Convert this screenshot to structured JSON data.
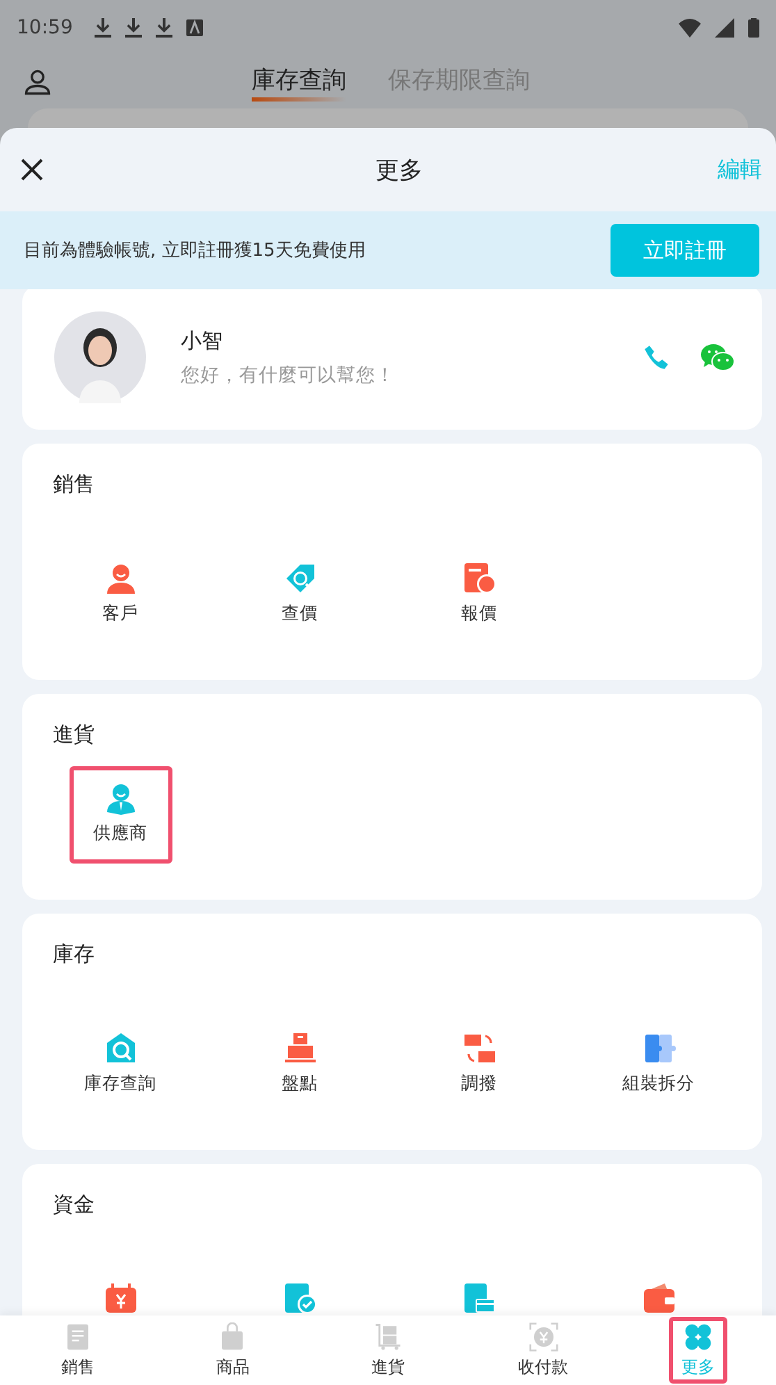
{
  "status_bar": {
    "time": "10:59"
  },
  "background_app": {
    "tabs": [
      {
        "label": "庫存查詢",
        "selected": true
      },
      {
        "label": "保存期限查詢",
        "selected": false
      }
    ]
  },
  "sheet": {
    "title": "更多",
    "edit": "編輯"
  },
  "banner": {
    "text": "目前為體驗帳號, 立即註冊獲15天免費使用",
    "button": "立即註冊"
  },
  "assistant": {
    "name": "小智",
    "greeting": "您好，有什麼可以幫您！"
  },
  "sections": [
    {
      "title": "銷售",
      "items": [
        {
          "label": "客戶",
          "highlighted": false
        },
        {
          "label": "查價",
          "highlighted": false
        },
        {
          "label": "報價",
          "highlighted": false
        }
      ]
    },
    {
      "title": "進貨",
      "items": [
        {
          "label": "供應商",
          "highlighted": true
        }
      ]
    },
    {
      "title": "庫存",
      "items": [
        {
          "label": "庫存查詢",
          "highlighted": false
        },
        {
          "label": "盤點",
          "highlighted": false
        },
        {
          "label": "調撥",
          "highlighted": false
        },
        {
          "label": "組裝拆分",
          "highlighted": false
        }
      ]
    },
    {
      "title": "資金",
      "items": [
        {
          "highlighted": false
        },
        {
          "highlighted": false
        },
        {
          "highlighted": false
        },
        {
          "highlighted": false
        }
      ]
    }
  ],
  "bottom_nav": [
    {
      "label": "銷售",
      "selected": false,
      "highlighted": false
    },
    {
      "label": "商品",
      "selected": false,
      "highlighted": false
    },
    {
      "label": "進貨",
      "selected": false,
      "highlighted": false
    },
    {
      "label": "收付款",
      "selected": false,
      "highlighted": false
    },
    {
      "label": "更多",
      "selected": true,
      "highlighted": true
    }
  ]
}
